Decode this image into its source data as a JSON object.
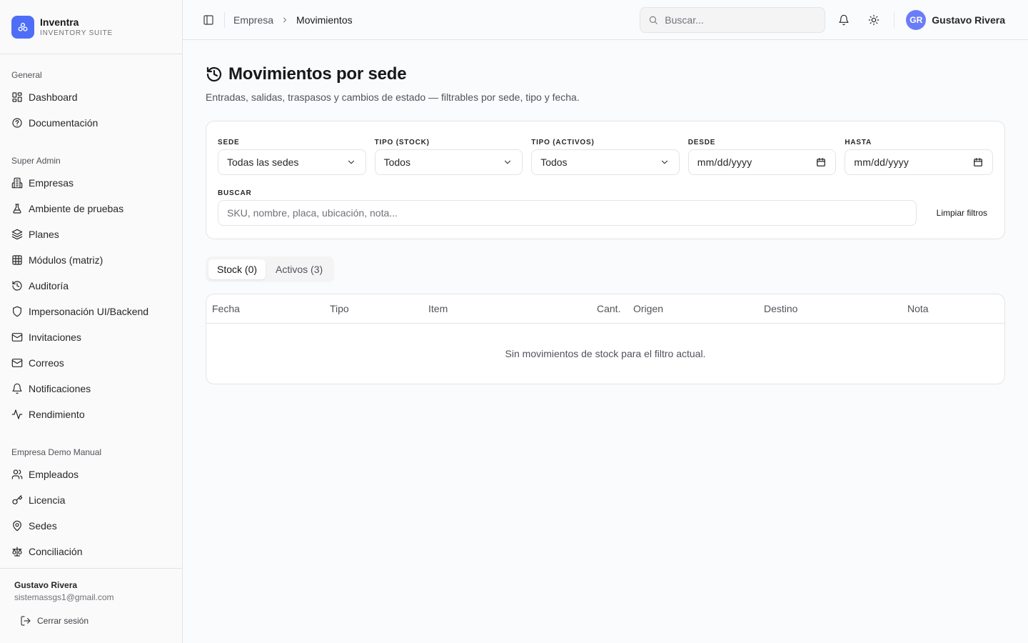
{
  "brand": {
    "name": "Inventra",
    "tagline": "INVENTORY SUITE"
  },
  "sidebar": {
    "groups": [
      {
        "label": "General",
        "items": [
          {
            "label": "Dashboard",
            "icon": "grid-icon"
          },
          {
            "label": "Documentación",
            "icon": "help-circle-icon"
          }
        ]
      },
      {
        "label": "Super Admin",
        "items": [
          {
            "label": "Empresas",
            "icon": "building-icon"
          },
          {
            "label": "Ambiente de pruebas",
            "icon": "flask-icon"
          },
          {
            "label": "Planes",
            "icon": "layers-icon"
          },
          {
            "label": "Módulos (matriz)",
            "icon": "table-icon"
          },
          {
            "label": "Auditoría",
            "icon": "history-icon"
          },
          {
            "label": "Impersonación UI/Backend",
            "icon": "shield-icon"
          },
          {
            "label": "Invitaciones",
            "icon": "mail-icon"
          },
          {
            "label": "Correos",
            "icon": "mail-icon"
          },
          {
            "label": "Notificaciones",
            "icon": "bell-icon"
          },
          {
            "label": "Rendimiento",
            "icon": "activity-icon"
          }
        ]
      },
      {
        "label": "Empresa Demo Manual",
        "items": [
          {
            "label": "Empleados",
            "icon": "users-icon"
          },
          {
            "label": "Licencia",
            "icon": "key-icon"
          },
          {
            "label": "Sedes",
            "icon": "map-pin-icon"
          },
          {
            "label": "Conciliación",
            "icon": "scale-icon"
          }
        ]
      }
    ],
    "user": {
      "name": "Gustavo Rivera",
      "email": "sistemassgs1@gmail.com"
    },
    "logout_label": "Cerrar sesión"
  },
  "header": {
    "breadcrumb": [
      "Empresa",
      "Movimientos"
    ],
    "search_placeholder": "Buscar...",
    "user_initials": "GR",
    "user_name": "Gustavo Rivera"
  },
  "page": {
    "title": "Movimientos por sede",
    "subtitle": "Entradas, salidas, traspasos y cambios de estado — filtrables por sede, tipo y fecha."
  },
  "filters": {
    "sede": {
      "label": "SEDE",
      "value": "Todas las sedes"
    },
    "tipo_stock": {
      "label": "TIPO (STOCK)",
      "value": "Todos"
    },
    "tipo_activos": {
      "label": "TIPO (ACTIVOS)",
      "value": "Todos"
    },
    "desde": {
      "label": "DESDE",
      "value": "mm/dd/yyyy"
    },
    "hasta": {
      "label": "HASTA",
      "value": "mm/dd/yyyy"
    },
    "buscar": {
      "label": "BUSCAR",
      "placeholder": "SKU, nombre, placa, ubicación, nota..."
    },
    "clear_label": "Limpiar filtros"
  },
  "tabs": [
    {
      "label": "Stock (0)",
      "active": true
    },
    {
      "label": "Activos (3)",
      "active": false
    }
  ],
  "table": {
    "columns": [
      "Fecha",
      "Tipo",
      "Item",
      "Cant.",
      "Origen",
      "Destino",
      "Nota"
    ],
    "empty_message": "Sin movimientos de stock para el filtro actual."
  },
  "colors": {
    "accent": "#4f6ef7",
    "avatar": "#6b7cf8"
  }
}
